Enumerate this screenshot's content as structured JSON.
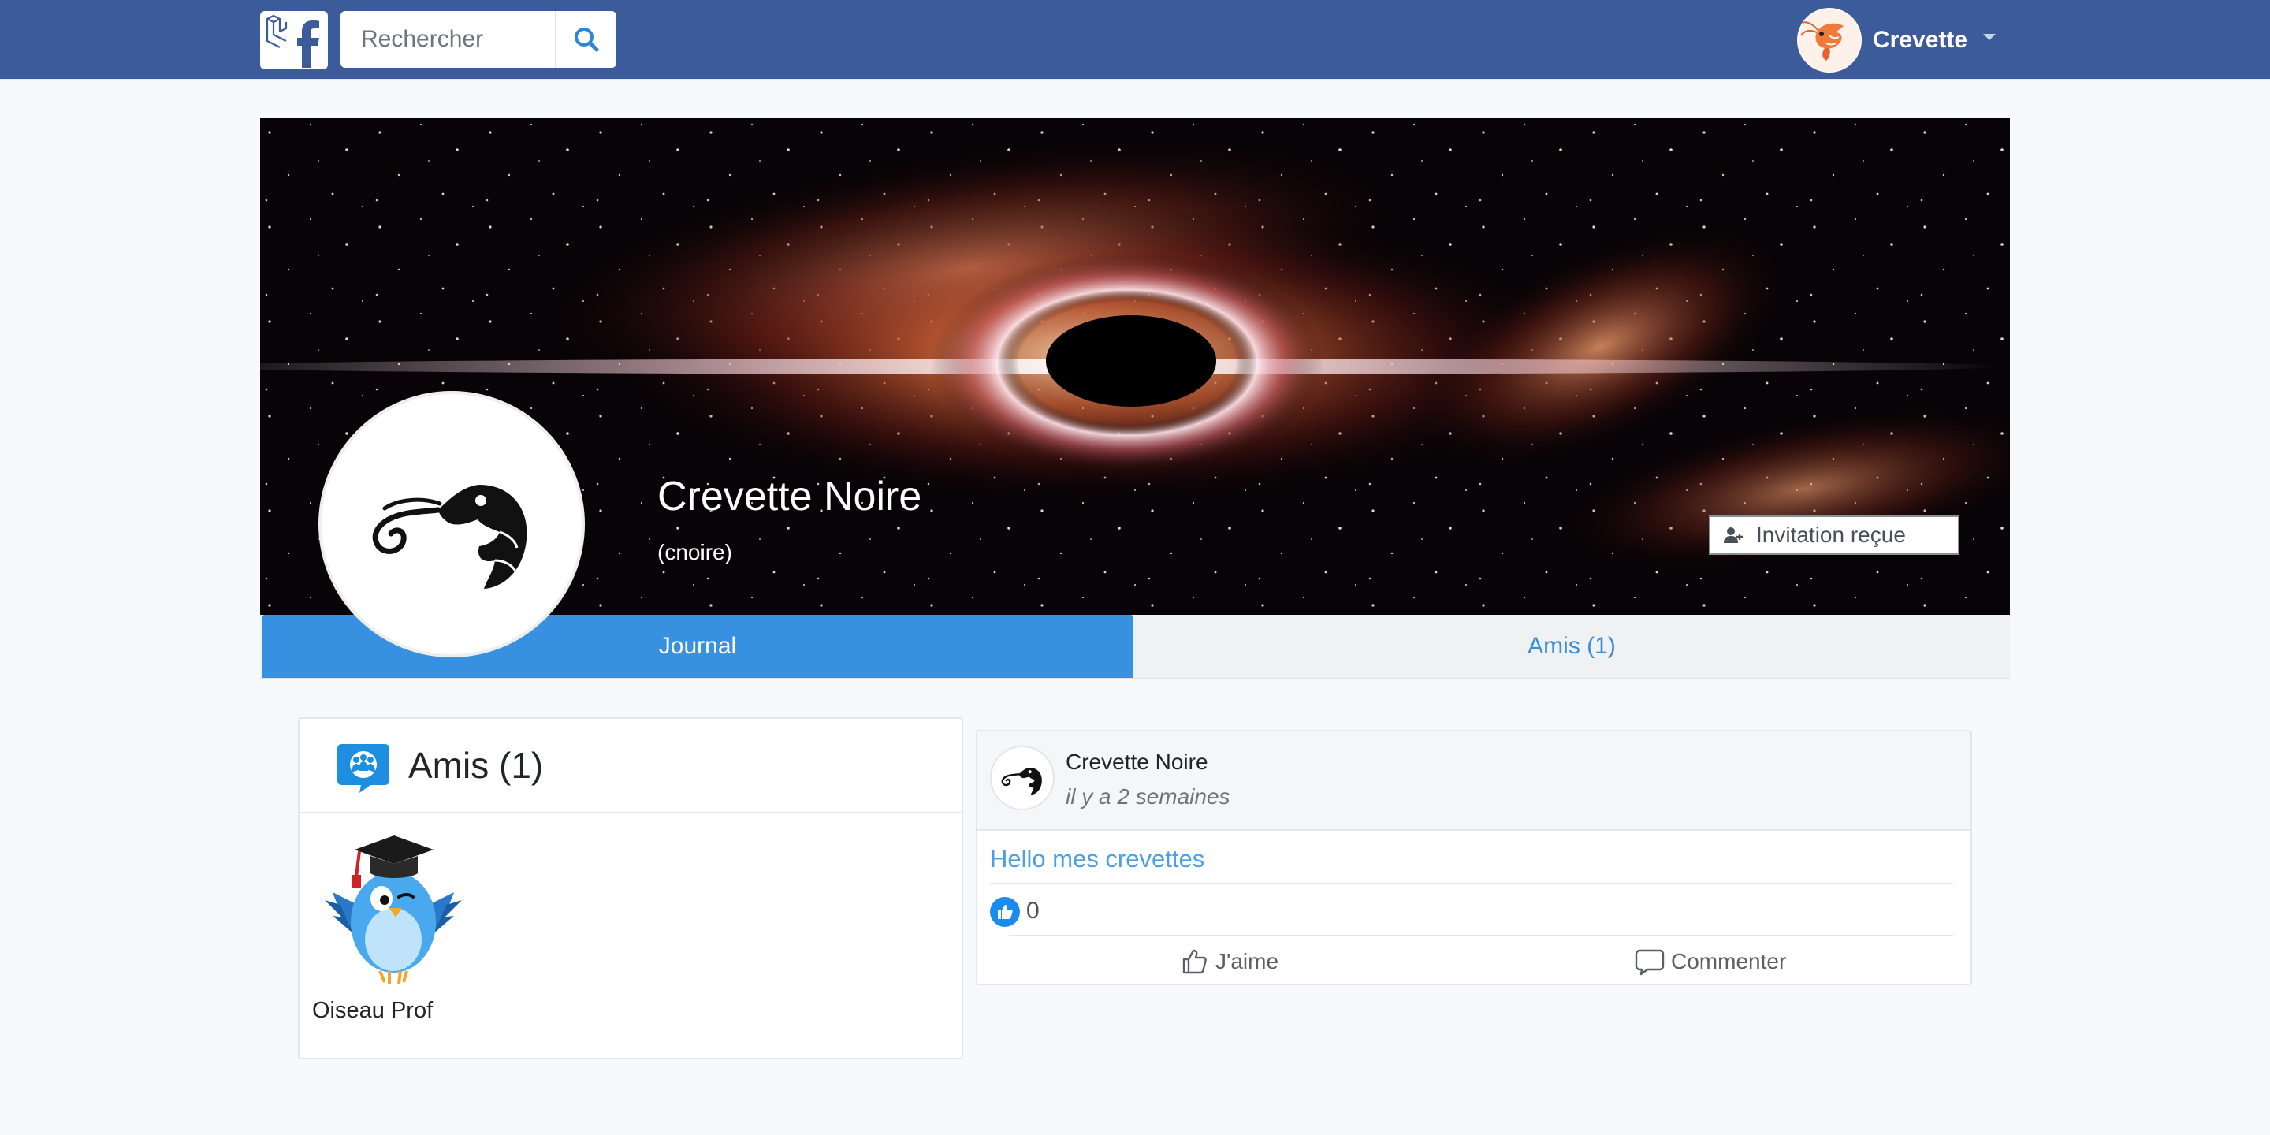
{
  "navbar": {
    "logo_icon": "laravel-facebook-logo",
    "search_placeholder": "Rechercher",
    "search_icon": "search-icon",
    "user_name": "Crevette",
    "caret_icon": "caret-down-icon",
    "background": "#3b5b9b"
  },
  "profile": {
    "name": "Crevette Noire",
    "username": "(cnoire)",
    "invite_label": "Invitation reçue",
    "invite_icon": "user-plus-icon"
  },
  "tabs": [
    {
      "label": "Journal",
      "active": true
    },
    {
      "label": "Amis (1)",
      "active": false
    }
  ],
  "friends": {
    "title": "Amis (1)",
    "icon": "friends-chat-icon",
    "items": [
      {
        "name": "Oiseau Prof"
      }
    ]
  },
  "post": {
    "author": "Crevette Noire",
    "time": "il y a 2 semaines",
    "text": "Hello mes crevettes",
    "like_count": "0",
    "like_label": "J'aime",
    "comment_label": "Commenter"
  },
  "colors": {
    "accent": "#3890e0",
    "link": "#4aa0e6",
    "like_badge": "#1a8cf0"
  }
}
